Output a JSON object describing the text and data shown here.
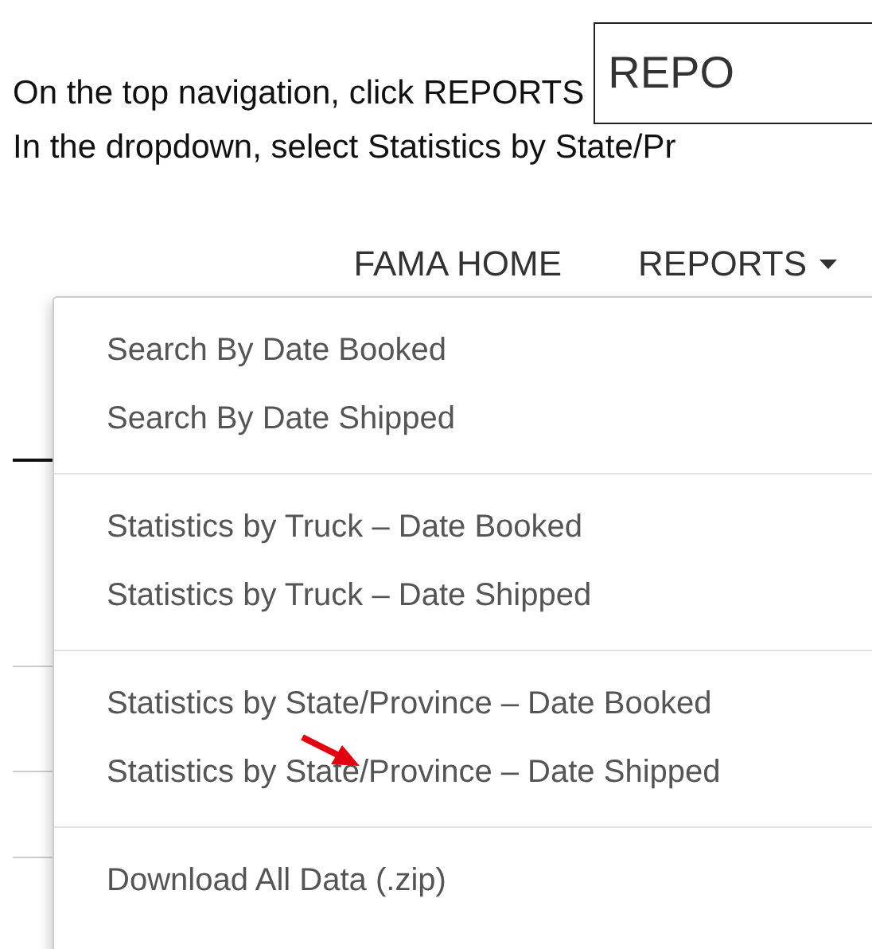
{
  "instructions": [
    {
      "text": "On the top navigation, click REPORTS"
    },
    {
      "text": "In the dropdown, select Statistics by State/Pr"
    }
  ],
  "inset": {
    "label": "REPO"
  },
  "nav": [
    {
      "label": "FAMA HOME",
      "dropdown": false
    },
    {
      "label": "REPORTS",
      "dropdown": true
    }
  ],
  "menu": {
    "groups": [
      {
        "items": [
          "Search By Date Booked",
          "Search By Date Shipped"
        ]
      },
      {
        "items": [
          "Statistics by Truck – Date Booked",
          "Statistics by Truck – Date Shipped"
        ]
      },
      {
        "items": [
          "Statistics by State/Province – Date Booked",
          "Statistics by State/Province – Date Shipped"
        ]
      },
      {
        "items": [
          "Download All Data (.zip)"
        ]
      }
    ]
  }
}
